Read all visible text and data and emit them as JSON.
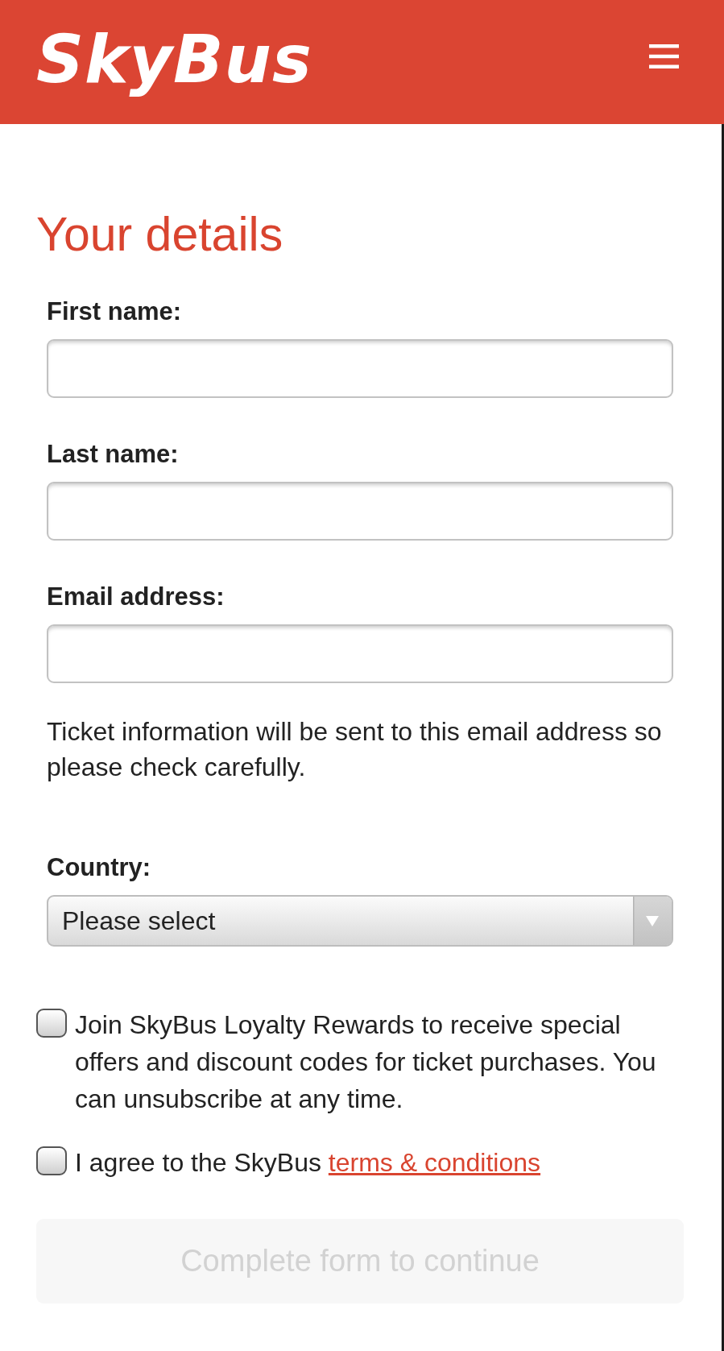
{
  "header": {
    "logo": "SkyBus"
  },
  "heading": "Your details",
  "fields": [
    {
      "kind": "text",
      "label": "First name:"
    },
    {
      "kind": "text",
      "label": "Last name:"
    },
    {
      "kind": "text",
      "label": "Email address:",
      "help": "Ticket information will be sent to this email address so please check carefully."
    },
    {
      "kind": "select",
      "label": "Country:",
      "value": "Please select"
    }
  ],
  "checkboxes": [
    {
      "text": "Join SkyBus Loyalty Rewards to receive special offers and discount codes for ticket purchases. You can unsubscribe at any time.",
      "checked": false
    },
    {
      "text": "I agree to the SkyBus",
      "link": "terms & conditions",
      "checked": false
    }
  ],
  "submit_button": {
    "label": "Complete form to continue",
    "disabled": true
  }
}
